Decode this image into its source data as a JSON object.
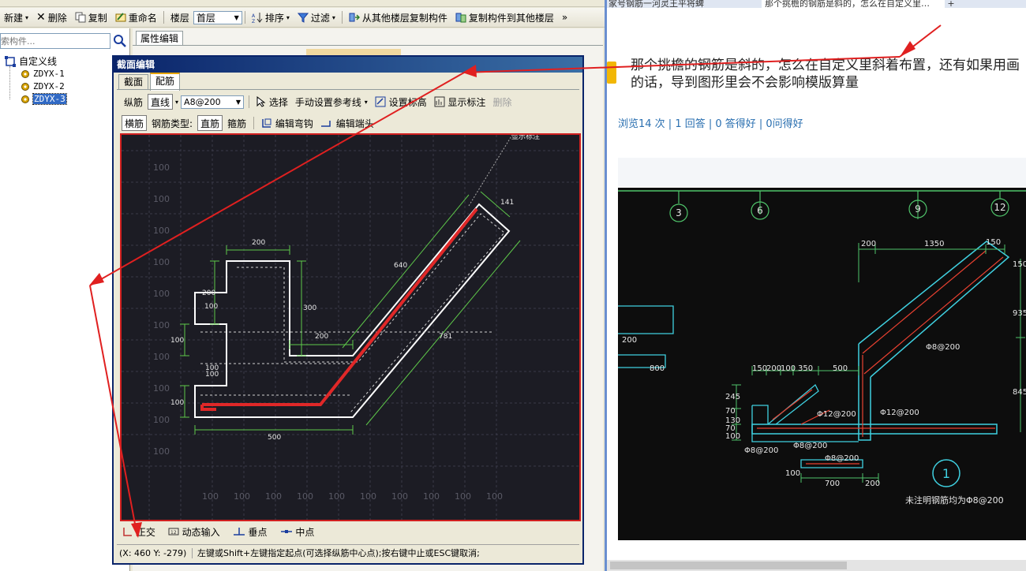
{
  "left_toolbar": {
    "new": "新建",
    "delete": "删除",
    "copy": "复制",
    "rename": "重命名",
    "floor_label": "楼层",
    "floor_value": "首层",
    "sort": "排序",
    "filter": "过滤",
    "copy_from_other": "从其他楼层复制构件",
    "copy_to_other": "复制构件到其他楼层",
    "more": "»"
  },
  "search": {
    "placeholder": "索构件..."
  },
  "tree": {
    "root": "自定义线",
    "items": [
      "ZDYX-1",
      "ZDYX-2",
      "ZDYX-3"
    ]
  },
  "property_tab": "属性编辑",
  "dialog": {
    "title": "截面编辑",
    "tabs": [
      "截面",
      "配筋"
    ],
    "row1": {
      "longitudinal": "纵筋",
      "line_mode": "直线",
      "rebar_spec": "A8@200",
      "select": "选择",
      "manual_ref": "手动设置参考线",
      "set_elevation": "设置标高",
      "show_dims": "显示标注",
      "delete": "删除"
    },
    "row2": {
      "transverse": "横筋",
      "rebar_type_label": "钢筋类型:",
      "straight": "直筋",
      "stirrup": "箍筋",
      "edit_hook": "编辑弯钩",
      "edit_end": "编辑端头"
    },
    "canvas_labels": {
      "dim_200_top": "200",
      "dim_200_left": "200",
      "dim_100_left": "100",
      "dim_300": "300",
      "dim_200_mid": "200",
      "dim_640": "640",
      "dim_141": "141",
      "dim_781": "781",
      "dim_100_side": "100",
      "dim_100_a": "100",
      "dim_100_b": "100",
      "dim_100_low": "100",
      "dim_500": "500",
      "grid_tick": "100",
      "corner_text": "显示标注"
    },
    "bottom_tools": {
      "ortho": "正交",
      "dynamic_input": "动态输入",
      "perpendicular": "垂点",
      "midpoint": "中点"
    },
    "status": {
      "coords": "(X: 460 Y: -279)",
      "hint": "左键或Shift+左键指定起点(可选择纵筋中心点);按右键中止或ESC键取消;"
    }
  },
  "browser": {
    "tabs": [
      "家号钢筋一河灵王平将蜱",
      "那个挑檐的钢筋是斜的，怎么在自定义里…",
      "+"
    ],
    "question": "那个挑檐的钢筋是斜的，怎么在自定义里斜着布置，还有如果用画的话，导到图形里会不会影响模版算量",
    "stats": "浏览14 次 | 1 回答 | 0 答得好 | 0问得好",
    "photo": {
      "axis_labels": [
        "3",
        "6",
        "9",
        "12"
      ],
      "dims": [
        "200",
        "1350",
        "150",
        "150",
        "935",
        "845",
        "200",
        "800",
        "150",
        "200",
        "100",
        "350",
        "500",
        "245",
        "70",
        "130",
        "70",
        "100",
        "700",
        "200",
        "100"
      ],
      "rebar_notes": [
        "Φ8@200",
        "Φ12@200",
        "Φ12@200",
        "Φ8@200",
        "Φ8@200",
        "Φ8@200"
      ],
      "circle_label": "1",
      "footnote": "未注明钢筋均为Φ8@200"
    }
  },
  "colors": {
    "annotation_red": "#e02020",
    "canvas_bg": "#1c1c24",
    "dim_green": "#5ec84a",
    "rebar_red": "#e02828",
    "link_blue": "#2a6fb0",
    "title_blue": "#0a246a"
  }
}
